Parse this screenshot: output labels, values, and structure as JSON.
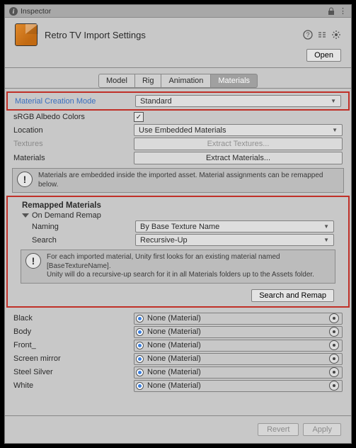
{
  "titlebar": {
    "title": "Inspector"
  },
  "header": {
    "asset_title": "Retro TV Import Settings",
    "open_label": "Open"
  },
  "tabs": {
    "model": "Model",
    "rig": "Rig",
    "animation": "Animation",
    "materials": "Materials",
    "active": "materials"
  },
  "fields": {
    "material_creation_mode_label": "Material Creation Mode",
    "material_creation_mode_value": "Standard",
    "srgb_label": "sRGB Albedo Colors",
    "srgb_checked": true,
    "location_label": "Location",
    "location_value": "Use Embedded Materials",
    "textures_label": "Textures",
    "textures_btn": "Extract Textures...",
    "materials_label": "Materials",
    "materials_btn": "Extract Materials..."
  },
  "embedded_info": "Materials are embedded inside the imported asset. Material assignments can be remapped below.",
  "remapped": {
    "section_title": "Remapped Materials",
    "foldout_title": "On Demand Remap",
    "naming_label": "Naming",
    "naming_value": "By Base Texture Name",
    "search_label": "Search",
    "search_value": "Recursive-Up",
    "help_text": "For each imported material, Unity first looks for an existing material named [BaseTextureName].\nUnity will do a recursive-up search for it in all Materials folders up to the Assets folder.",
    "search_remap_btn": "Search and Remap"
  },
  "materials_list": [
    {
      "name": "Black",
      "value": "None (Material)"
    },
    {
      "name": "Body",
      "value": "None (Material)"
    },
    {
      "name": "Front_",
      "value": "None (Material)"
    },
    {
      "name": "Screen mirror",
      "value": "None (Material)"
    },
    {
      "name": "Steel Silver",
      "value": "None (Material)"
    },
    {
      "name": "White",
      "value": "None (Material)"
    }
  ],
  "footer": {
    "revert": "Revert",
    "apply": "Apply"
  }
}
